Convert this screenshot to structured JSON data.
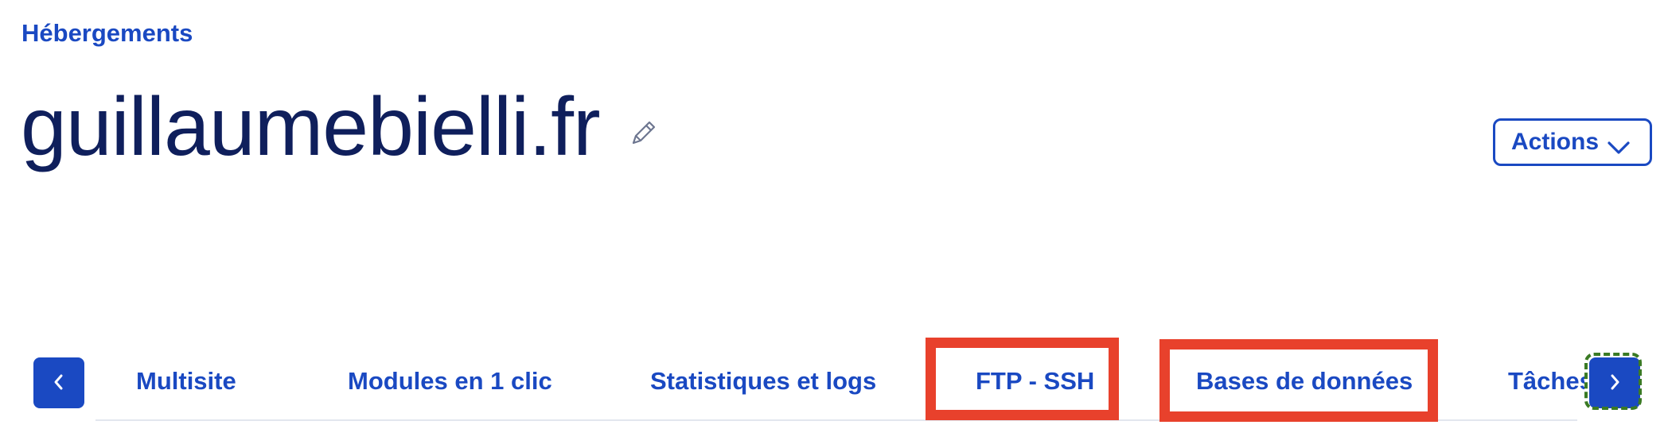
{
  "breadcrumb": {
    "label": "Hébergements"
  },
  "header": {
    "title": "guillaumebielli.fr",
    "edit_icon": "pencil-icon",
    "actions_label": "Actions",
    "actions_icon": "chevron-down-icon"
  },
  "tabs": {
    "items": [
      {
        "label": "Multisite"
      },
      {
        "label": "Modules en 1 clic"
      },
      {
        "label": "Statistiques et logs"
      },
      {
        "label": "FTP - SSH",
        "highlighted": true
      },
      {
        "label": "Bases de données",
        "highlighted": true
      },
      {
        "label": "Tâches"
      }
    ],
    "prev_icon": "chevron-left-icon",
    "next_icon": "chevron-right-icon"
  },
  "colors": {
    "accent": "#1a49c2",
    "title": "#0f1f5c",
    "highlight": "#e8412c",
    "focus_ring": "#3a7a24",
    "divider": "#e2e6ee"
  }
}
